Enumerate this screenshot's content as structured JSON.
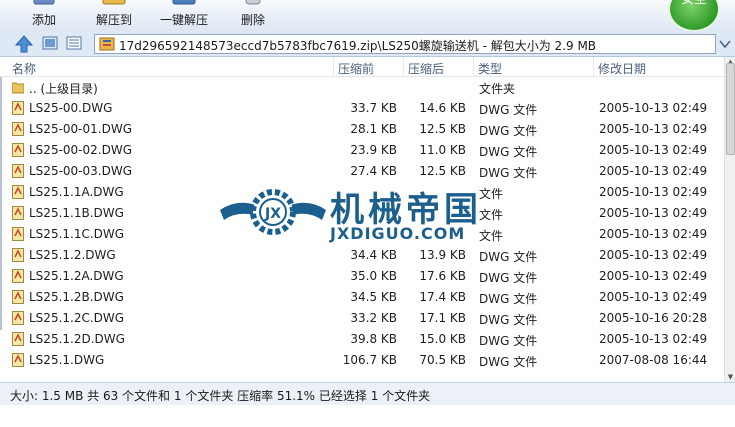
{
  "toolbar": {
    "buttons": [
      {
        "label": "添加",
        "icon": "add-icon"
      },
      {
        "label": "解压到",
        "icon": "extract-to-icon"
      },
      {
        "label": "一键解压",
        "icon": "one-click-extract-icon"
      },
      {
        "label": "删除",
        "icon": "delete-icon"
      }
    ],
    "badge_text": "安全"
  },
  "address": {
    "path": "17d296592148573eccd7b5783fbc7619.zip\\LS250螺旋输送机 - 解包大小为 2.9 MB"
  },
  "columns": {
    "name": "名称",
    "size": "压缩前",
    "packed": "压缩后",
    "type": "类型",
    "modified": "修改日期"
  },
  "files": [
    {
      "name": ".. (上级目录)",
      "size": "",
      "packed": "",
      "type": "文件夹",
      "modified": "",
      "kind": "folder"
    },
    {
      "name": "LS25-00.DWG",
      "size": "33.7 KB",
      "packed": "14.6 KB",
      "type": "DWG 文件",
      "modified": "2005-10-13 02:49",
      "kind": "dwg"
    },
    {
      "name": "LS25-00-01.DWG",
      "size": "28.1 KB",
      "packed": "12.5 KB",
      "type": "DWG 文件",
      "modified": "2005-10-13 02:49",
      "kind": "dwg"
    },
    {
      "name": "LS25-00-02.DWG",
      "size": "23.9 KB",
      "packed": "11.0 KB",
      "type": "DWG 文件",
      "modified": "2005-10-13 02:49",
      "kind": "dwg"
    },
    {
      "name": "LS25-00-03.DWG",
      "size": "27.4 KB",
      "packed": "12.5 KB",
      "type": "DWG 文件",
      "modified": "2005-10-13 02:49",
      "kind": "dwg"
    },
    {
      "name": "LS25.1.1A.DWG",
      "size": "",
      "packed": "",
      "type": "文件",
      "modified": "2005-10-13 02:49",
      "kind": "dwg"
    },
    {
      "name": "LS25.1.1B.DWG",
      "size": "",
      "packed": "",
      "type": "文件",
      "modified": "2005-10-13 02:49",
      "kind": "dwg"
    },
    {
      "name": "LS25.1.1C.DWG",
      "size": "",
      "packed": "",
      "type": "文件",
      "modified": "2005-10-13 02:49",
      "kind": "dwg"
    },
    {
      "name": "LS25.1.2.DWG",
      "size": "34.4 KB",
      "packed": "13.9 KB",
      "type": "DWG 文件",
      "modified": "2005-10-13 02:49",
      "kind": "dwg"
    },
    {
      "name": "LS25.1.2A.DWG",
      "size": "35.0 KB",
      "packed": "17.6 KB",
      "type": "DWG 文件",
      "modified": "2005-10-13 02:49",
      "kind": "dwg"
    },
    {
      "name": "LS25.1.2B.DWG",
      "size": "34.5 KB",
      "packed": "17.4 KB",
      "type": "DWG 文件",
      "modified": "2005-10-13 02:49",
      "kind": "dwg"
    },
    {
      "name": "LS25.1.2C.DWG",
      "size": "33.2 KB",
      "packed": "17.1 KB",
      "type": "DWG 文件",
      "modified": "2005-10-16 20:28",
      "kind": "dwg"
    },
    {
      "name": "LS25.1.2D.DWG",
      "size": "39.8 KB",
      "packed": "15.0 KB",
      "type": "DWG 文件",
      "modified": "2005-10-13 02:49",
      "kind": "dwg"
    },
    {
      "name": "LS25.1.DWG",
      "size": "106.7 KB",
      "packed": "70.5 KB",
      "type": "DWG 文件",
      "modified": "2007-08-08 16:44",
      "kind": "dwg"
    }
  ],
  "status": {
    "text": "大小: 1.5 MB 共 63 个文件和 1 个文件夹 压缩率 51.1% 已经选择 1 个文件夹"
  },
  "watermark": {
    "cn": "机械帝国",
    "en": "JXDIGUO.COM",
    "emblem": "JX"
  },
  "colors": {
    "toolbar_bg": "#e6eef7",
    "watermark_blue": "#1a5f8e",
    "badge_green": "#2f9a28"
  }
}
